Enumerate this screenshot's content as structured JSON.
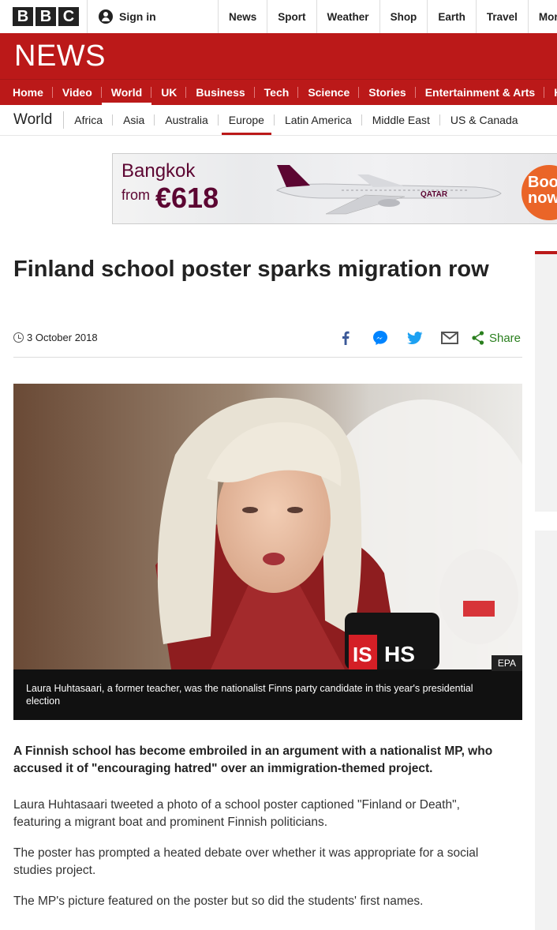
{
  "topbar": {
    "logo_letters": [
      "B",
      "B",
      "C"
    ],
    "signin_label": "Sign in",
    "nav": [
      "News",
      "Sport",
      "Weather",
      "Shop",
      "Earth",
      "Travel",
      "More"
    ]
  },
  "banner": {
    "logo": "NEWS"
  },
  "section_nav": {
    "items": [
      "Home",
      "Video",
      "World",
      "UK",
      "Business",
      "Tech",
      "Science",
      "Stories",
      "Entertainment & Arts",
      "Hea"
    ],
    "active": "World"
  },
  "world_nav": {
    "title": "World",
    "items": [
      "Africa",
      "Asia",
      "Australia",
      "Europe",
      "Latin America",
      "Middle East",
      "US & Canada"
    ],
    "active": "Europe"
  },
  "ad": {
    "destination": "Bangkok",
    "from_label": "from",
    "price": "€618",
    "airline": "QATAR",
    "cta": "Book now",
    "brand_color": "#5c0632",
    "cta_color": "#ea6528"
  },
  "article": {
    "headline": "Finland school poster sparks migration row",
    "date": "3 October 2018",
    "share_label": "Share",
    "image_credit": "EPA",
    "caption": "Laura Huhtasaari, a former teacher, was the nationalist Finns party candidate in this year's presidential election",
    "lead": "A Finnish school has become embroiled in an argument with a nationalist MP, who accused it of \"encouraging hatred\" over an immigration-themed project.",
    "paragraphs": [
      "Laura Huhtasaari tweeted a photo of a school poster captioned \"Finland or Death\", featuring a migrant boat and prominent Finnish politicians.",
      "The poster has prompted a heated debate over whether it was appropriate for a social studies project.",
      "The MP's picture featured on the poster but so did the students' first names."
    ]
  },
  "colors": {
    "bbc_red": "#bb1919",
    "share_green": "#2a7f1e"
  }
}
